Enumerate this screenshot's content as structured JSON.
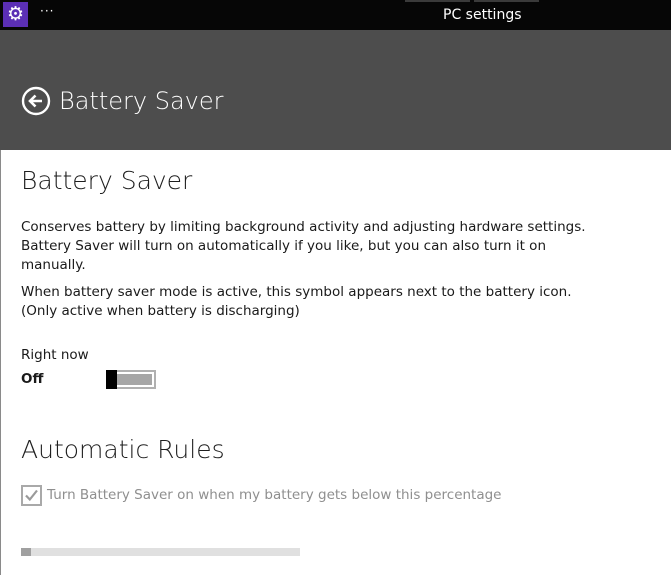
{
  "titlebar": {
    "app_icon": "gear-icon",
    "more_label": "···",
    "title": "PC settings"
  },
  "header": {
    "back_icon": "back-arrow-icon",
    "title": "Battery Saver"
  },
  "main": {
    "section_title": "Battery Saver",
    "description": "Conserves battery by limiting background activity and adjusting hardware settings. Battery Saver will turn on automatically if you like, but you can also turn it on manually.",
    "symbol_note": "When battery saver mode is active, this symbol appears next to the battery icon. (Only active when battery is discharging)",
    "right_now_label": "Right now",
    "toggle_state": "Off",
    "toggle_on": false
  },
  "rules": {
    "title": "Automatic Rules",
    "checkbox_label": "Turn Battery Saver on when my battery gets below this percentage",
    "checkbox_checked": true,
    "checkbox_enabled": false,
    "slider_level_fraction": 0.035
  },
  "colors": {
    "titlebar_bg": "#060606",
    "app_icon_bg": "#5b2fb5",
    "header_bg": "#4d4d4d",
    "disabled_text": "#8f8f8f"
  }
}
